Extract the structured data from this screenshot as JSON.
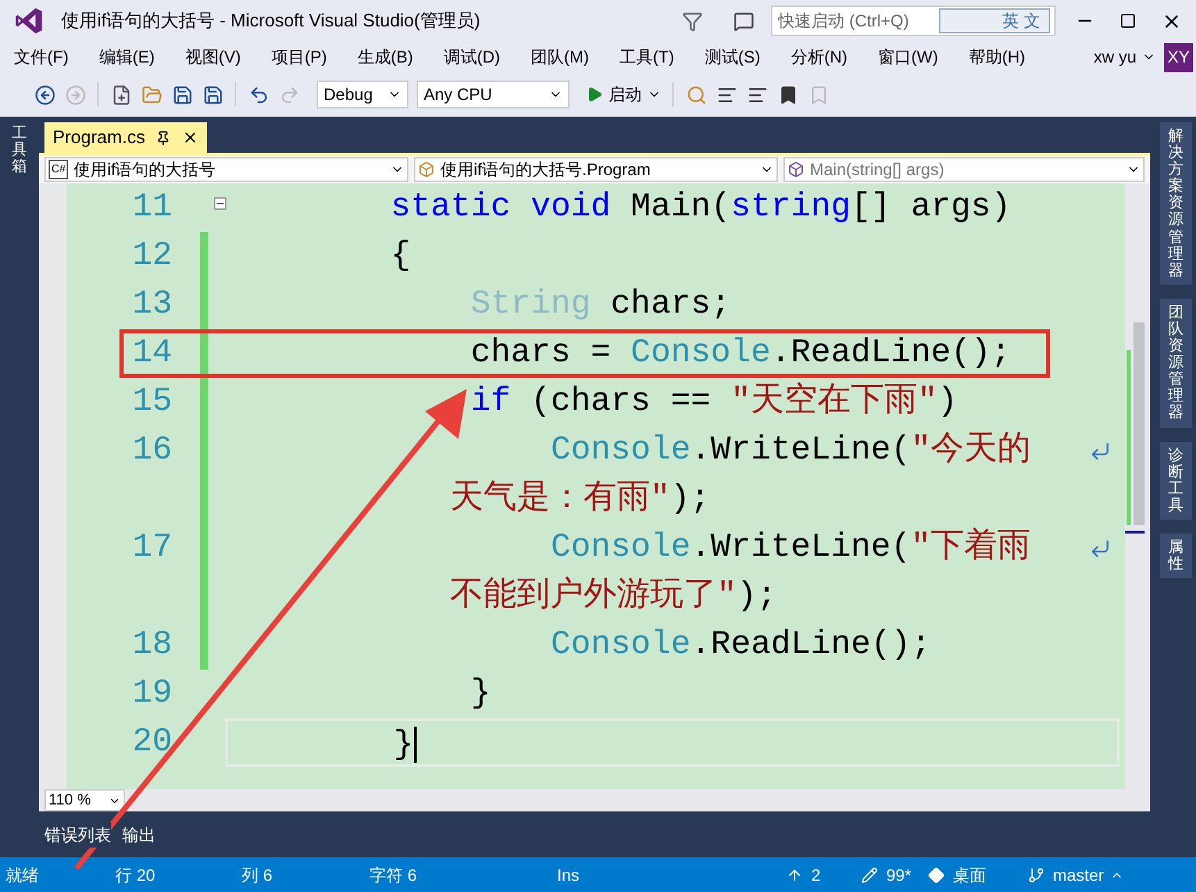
{
  "window": {
    "title": "使用if语句的大括号 - Microsoft Visual Studio(管理员)",
    "quick_launch": {
      "placeholder": "快速启动 (Ctrl+Q)"
    },
    "ime_indicator": "英 文"
  },
  "menu": [
    "文件(F)",
    "编辑(E)",
    "视图(V)",
    "项目(P)",
    "生成(B)",
    "调试(D)",
    "团队(M)",
    "工具(T)",
    "测试(S)",
    "分析(N)",
    "窗口(W)",
    "帮助(H)"
  ],
  "account": {
    "user": "xw yu",
    "avatar": "XY"
  },
  "toolbar": {
    "configuration": "Debug",
    "platform": "Any CPU",
    "start": "启动"
  },
  "left_panel": {
    "toolbox": "工具箱"
  },
  "tabs": [
    {
      "label": "Program.cs",
      "selected": true
    }
  ],
  "navigation": {
    "project_badge": "C#",
    "project": "使用if语句的大括号",
    "class": "使用if语句的大括号.Program",
    "member": "Main(string[] args)"
  },
  "lines": [
    {
      "number": "11",
      "changed": false,
      "collapsible": true,
      "annotated": false,
      "current": false,
      "tokens": [
        {
          "text": "        static",
          "kind": "keyword"
        },
        {
          "text": " void",
          "kind": "keyword"
        },
        {
          "text": " Main(",
          "kind": "plain"
        },
        {
          "text": "string",
          "kind": "keyword"
        },
        {
          "text": "[] args)",
          "kind": "plain"
        }
      ]
    },
    {
      "number": "12",
      "changed": true,
      "collapsible": false,
      "annotated": false,
      "current": false,
      "tokens": [
        {
          "text": "        {",
          "kind": "plain"
        }
      ]
    },
    {
      "number": "13",
      "changed": true,
      "collapsible": false,
      "annotated": false,
      "current": false,
      "tokens": [
        {
          "text": "            String",
          "kind": "faded"
        },
        {
          "text": " chars;",
          "kind": "plain"
        }
      ]
    },
    {
      "number": "14",
      "changed": true,
      "collapsible": false,
      "annotated": true,
      "current": false,
      "tokens": [
        {
          "text": "            chars = ",
          "kind": "plain"
        },
        {
          "text": "Console",
          "kind": "type"
        },
        {
          "text": ".ReadLine();",
          "kind": "plain"
        }
      ]
    },
    {
      "number": "15",
      "changed": true,
      "collapsible": false,
      "annotated": false,
      "current": false,
      "tokens": [
        {
          "text": "            if",
          "kind": "keyword"
        },
        {
          "text": " (chars == ",
          "kind": "plain"
        },
        {
          "text": "\"天空在下雨\"",
          "kind": "string"
        },
        {
          "text": ")",
          "kind": "plain"
        }
      ]
    },
    {
      "number": "16",
      "changed": true,
      "collapsible": false,
      "annotated": false,
      "current": false,
      "tokens": [
        {
          "text": "                Console",
          "kind": "type"
        },
        {
          "text": ".WriteLine(",
          "kind": "plain"
        },
        {
          "text": "\"今天的",
          "kind": "string"
        }
      ],
      "wrapped": [
        {
          "text": "天气是：有雨\"",
          "kind": "string"
        },
        {
          "text": ");",
          "kind": "plain"
        }
      ]
    },
    {
      "number": "17",
      "changed": true,
      "collapsible": false,
      "annotated": false,
      "current": false,
      "tokens": [
        {
          "text": "                Console",
          "kind": "type"
        },
        {
          "text": ".WriteLine(",
          "kind": "plain"
        },
        {
          "text": "\"下着雨",
          "kind": "string"
        }
      ],
      "wrapped": [
        {
          "text": "不能到户外游玩了\"",
          "kind": "string"
        },
        {
          "text": ");",
          "kind": "plain"
        }
      ]
    },
    {
      "number": "18",
      "changed": true,
      "collapsible": false,
      "annotated": false,
      "current": false,
      "tokens": [
        {
          "text": "                Console",
          "kind": "type"
        },
        {
          "text": ".ReadLine();",
          "kind": "plain"
        }
      ]
    },
    {
      "number": "19",
      "changed": false,
      "collapsible": false,
      "annotated": false,
      "current": false,
      "tokens": [
        {
          "text": "            }",
          "kind": "plain"
        }
      ]
    },
    {
      "number": "20",
      "changed": false,
      "collapsible": false,
      "annotated": false,
      "current": true,
      "tokens": [
        {
          "text": "        }",
          "kind": "plain"
        }
      ]
    }
  ],
  "zoom": "110 %",
  "tool_tabs": [
    "错误列表",
    "输出"
  ],
  "right_panel": [
    "解决方案资源管理器",
    "团队资源管理器",
    "诊断工具",
    "属性"
  ],
  "status_bar": {
    "state": "就绪",
    "line": "行 20",
    "column": "列 6",
    "char": "字符 6",
    "mode": "Ins",
    "pushes": "2",
    "changes": "99*",
    "repo": "桌面",
    "branch": "master"
  }
}
